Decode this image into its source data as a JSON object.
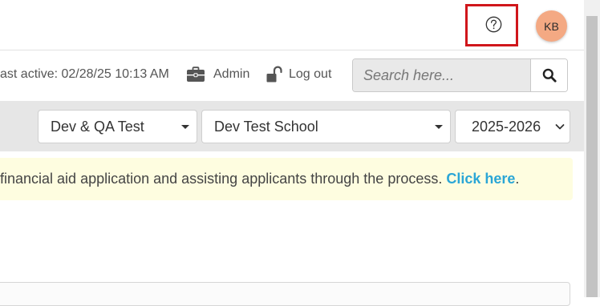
{
  "header": {
    "help_icon": "question-circle-icon",
    "avatar_initials": "KB",
    "colors": {
      "highlight": "#d0161b",
      "avatar_bg": "#f4a983"
    }
  },
  "status_bar": {
    "last_active": "ast active: 02/28/25 10:13 AM",
    "admin_label": "Admin",
    "logout_label": "Log out",
    "briefcase_icon": "briefcase-icon",
    "lock_icon": "unlock-icon"
  },
  "search": {
    "placeholder": "Search here...",
    "value": "",
    "button_icon": "search-icon"
  },
  "filters": {
    "organization": "Dev & QA Test",
    "school": "Dev Test School",
    "year": "2025-2026"
  },
  "notice": {
    "text": "financial aid application and assisting applicants through the process. ",
    "link_label": "Click here",
    "suffix": ".",
    "colors": {
      "background": "#fefde0",
      "link": "#2aa6d6"
    }
  }
}
